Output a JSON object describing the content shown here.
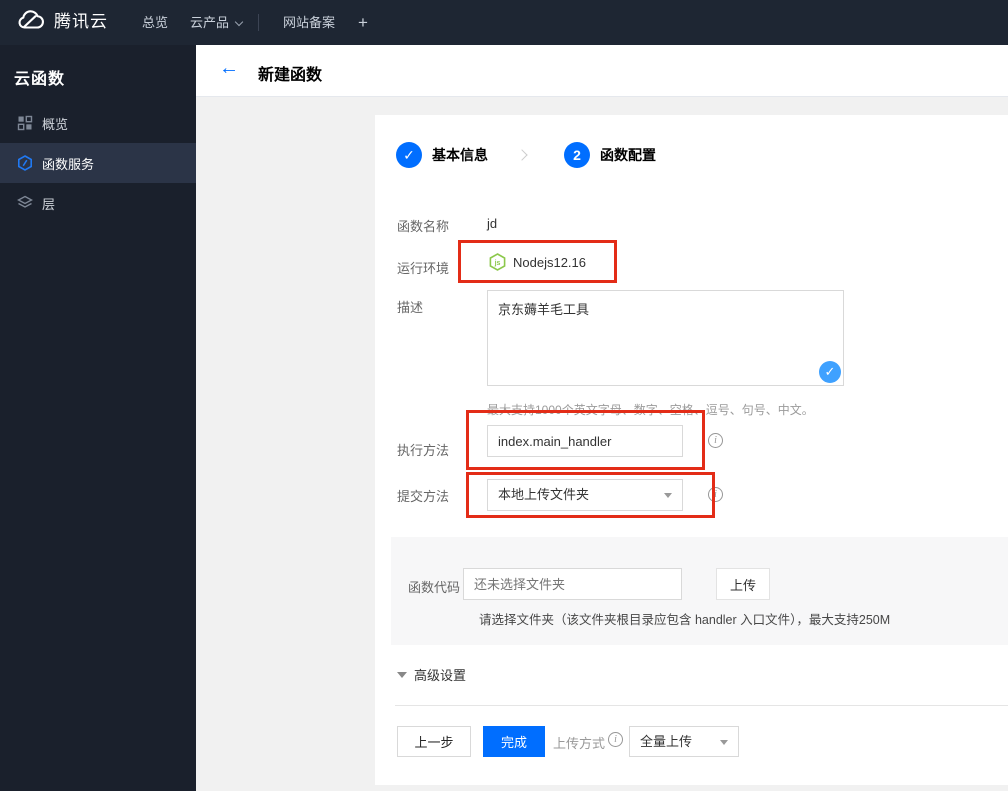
{
  "topnav": {
    "brand": "腾讯云",
    "overview": "总览",
    "products": "云产品",
    "icp": "网站备案",
    "plus": "+"
  },
  "sidebar": {
    "title": "云函数",
    "items": [
      {
        "label": "概览"
      },
      {
        "label": "函数服务"
      },
      {
        "label": "层"
      }
    ]
  },
  "header": {
    "title": "新建函数"
  },
  "steps": {
    "step1_label": "基本信息",
    "step2_num": "2",
    "step2_label": "函数配置"
  },
  "form": {
    "name_label": "函数名称",
    "name_value": "jd",
    "runtime_label": "运行环境",
    "runtime_value": "Nodejs12.16",
    "desc_label": "描述",
    "desc_value": "京东薅羊毛工具",
    "desc_hint": "最大支持1000个英文字母、数字、空格、逗号、句号、中文。",
    "handler_label": "执行方法",
    "handler_value": "index.main_handler",
    "submit_label": "提交方法",
    "submit_value": "本地上传文件夹",
    "code_label": "函数代码",
    "code_required": "*",
    "code_placeholder": "还未选择文件夹",
    "upload_button": "上传",
    "code_hint": "请选择文件夹（该文件夹根目录应包含 handler 入口文件），最大支持250M",
    "advanced_label": "高级设置"
  },
  "footer": {
    "prev": "上一步",
    "finish": "完成",
    "upload_mode_label": "上传方式",
    "upload_mode_value": "全量上传"
  },
  "icons": {
    "back_arrow": "←",
    "check": "✓",
    "info": "i"
  },
  "colors": {
    "brand_blue": "#006eff",
    "annotation_red": "#e32c17",
    "node_green": "#8cc84b",
    "desc_check_blue": "#3fa1ff",
    "topnav_bg": "#1e2633",
    "sidebar_bg": "#1a202c",
    "sidebar_active_bg": "#2b3447"
  }
}
